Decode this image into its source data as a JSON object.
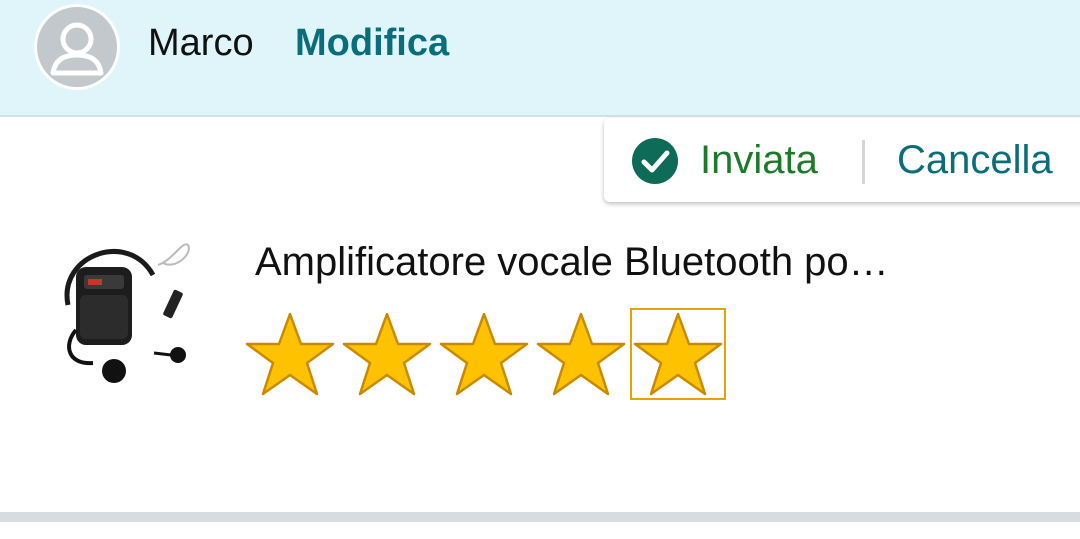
{
  "header": {
    "user_name": "Marco",
    "edit_label": "Modifica",
    "avatar_icon": "user-avatar-icon"
  },
  "status": {
    "sent_label": "Inviata",
    "cancel_label": "Cancella",
    "check_icon": "check-circle-icon"
  },
  "product": {
    "title": "Amplificatore vocale Bluetooth po…",
    "rating": 5,
    "max_rating": 5
  },
  "colors": {
    "header_bg": "#dff5fa",
    "link": "#0a6e7a",
    "success": "#1e7a2b",
    "star_fill": "#ffc200",
    "star_outline": "#c98a00"
  }
}
